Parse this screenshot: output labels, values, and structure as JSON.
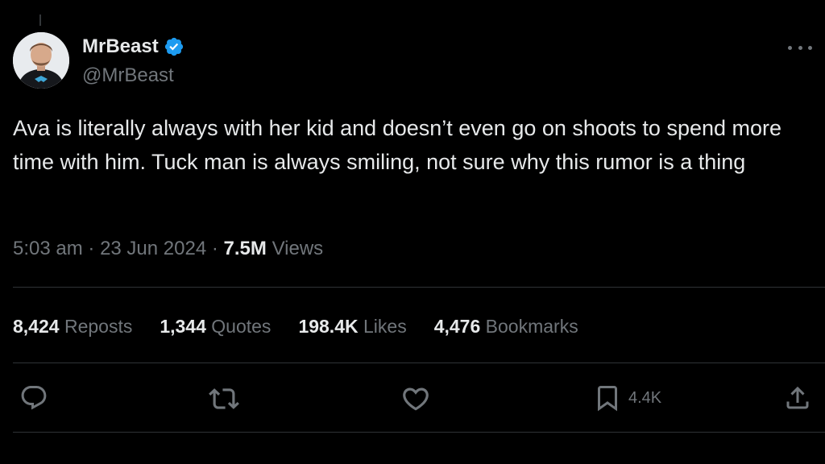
{
  "author": {
    "display_name": "MrBeast",
    "handle": "@MrBeast",
    "verified": true,
    "verified_color": "#1d9bf0"
  },
  "tweet": {
    "text": "Ava is literally always with her kid and doesn’t even go on shoots to spend more time with him. Tuck man is always smiling, not sure why this rumor is a thing",
    "time": "5:03 am",
    "date": "23 Jun 2024",
    "separator": "·",
    "views_count": "7.5M",
    "views_label": "Views"
  },
  "stats": [
    {
      "count": "8,424",
      "label": "Reposts"
    },
    {
      "count": "1,344",
      "label": "Quotes"
    },
    {
      "count": "198.4K",
      "label": "Likes"
    },
    {
      "count": "4,476",
      "label": "Bookmarks"
    }
  ],
  "actions": {
    "reply_icon": "reply-icon",
    "repost_icon": "repost-icon",
    "like_icon": "heart-icon",
    "bookmark_icon": "bookmark-icon",
    "bookmark_count": "4.4K",
    "share_icon": "share-icon"
  },
  "colors": {
    "background": "#000000",
    "text_primary": "#e7e9ea",
    "text_secondary": "#71767b",
    "divider": "#2f3336"
  }
}
